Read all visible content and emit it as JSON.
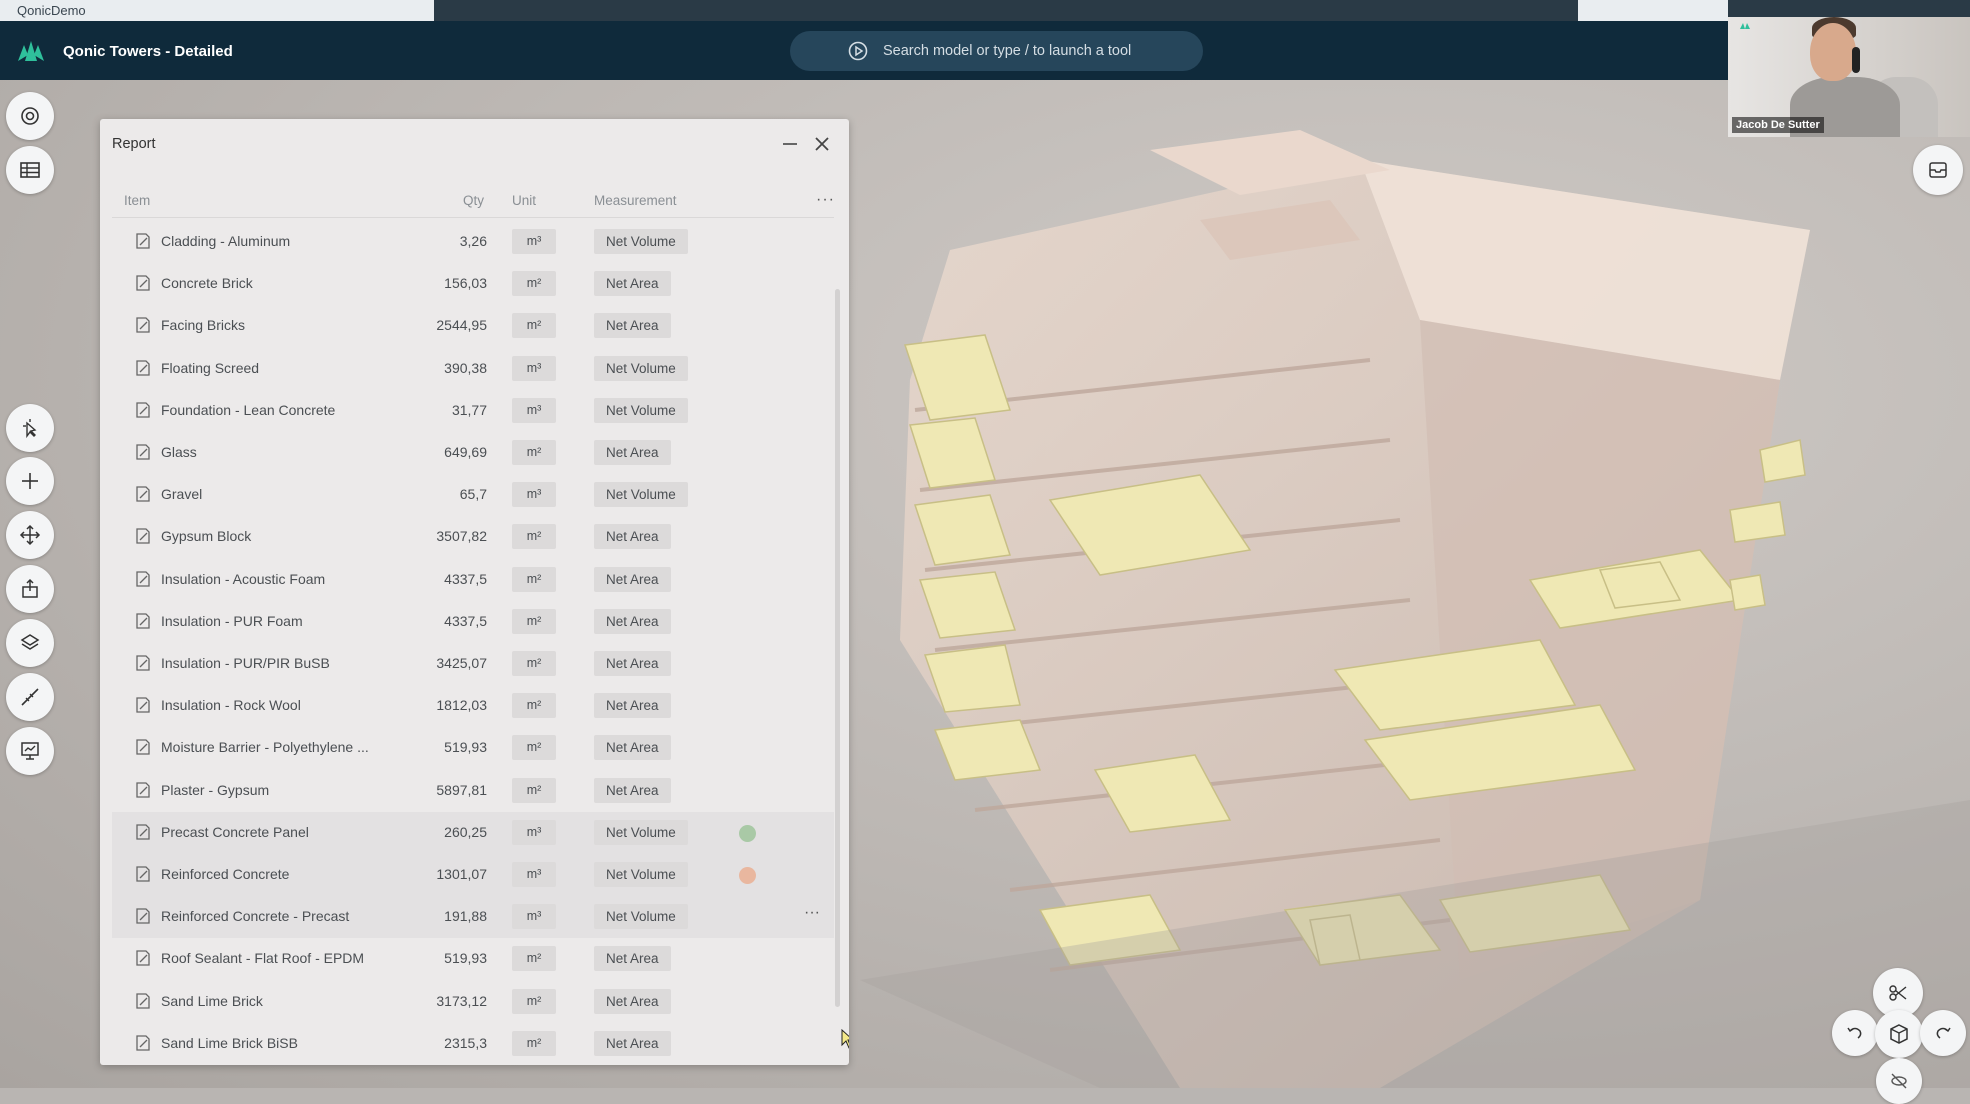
{
  "browser": {
    "tab_title": "QonicDemo"
  },
  "app": {
    "title": "Qonic Towers - Detailed",
    "search_placeholder": "Search model or type / to launch a tool"
  },
  "video": {
    "participant_name": "Jacob De Sutter"
  },
  "report": {
    "title": "Report",
    "columns": {
      "item": "Item",
      "qty": "Qty",
      "unit": "Unit",
      "measurement": "Measurement"
    },
    "rows": [
      {
        "item": "Cladding - Aluminum",
        "qty": "3,26",
        "unit": "m³",
        "measurement": "Net Volume"
      },
      {
        "item": "Concrete Brick",
        "qty": "156,03",
        "unit": "m²",
        "measurement": "Net Area"
      },
      {
        "item": "Facing Bricks",
        "qty": "2544,95",
        "unit": "m²",
        "measurement": "Net Area"
      },
      {
        "item": "Floating Screed",
        "qty": "390,38",
        "unit": "m³",
        "measurement": "Net Volume"
      },
      {
        "item": "Foundation - Lean Concrete",
        "qty": "31,77",
        "unit": "m³",
        "measurement": "Net Volume"
      },
      {
        "item": "Glass",
        "qty": "649,69",
        "unit": "m²",
        "measurement": "Net Area"
      },
      {
        "item": "Gravel",
        "qty": "65,7",
        "unit": "m³",
        "measurement": "Net Volume"
      },
      {
        "item": "Gypsum Block",
        "qty": "3507,82",
        "unit": "m²",
        "measurement": "Net Area"
      },
      {
        "item": "Insulation - Acoustic Foam",
        "qty": "4337,5",
        "unit": "m²",
        "measurement": "Net Area"
      },
      {
        "item": "Insulation - PUR Foam",
        "qty": "4337,5",
        "unit": "m²",
        "measurement": "Net Area"
      },
      {
        "item": "Insulation - PUR/PIR BuSB",
        "qty": "3425,07",
        "unit": "m²",
        "measurement": "Net Area"
      },
      {
        "item": "Insulation - Rock Wool",
        "qty": "1812,03",
        "unit": "m²",
        "measurement": "Net Area"
      },
      {
        "item": "Moisture Barrier - Polyethylene ...",
        "qty": "519,93",
        "unit": "m²",
        "measurement": "Net Area"
      },
      {
        "item": "Plaster - Gypsum",
        "qty": "5897,81",
        "unit": "m²",
        "measurement": "Net Area"
      },
      {
        "item": "Precast Concrete Panel",
        "qty": "260,25",
        "unit": "m³",
        "measurement": "Net Volume",
        "dot": "#a9c9a6"
      },
      {
        "item": "Reinforced Concrete",
        "qty": "1301,07",
        "unit": "m³",
        "measurement": "Net Volume",
        "dot": "#e9b79f"
      },
      {
        "item": "Reinforced Concrete - Precast",
        "qty": "191,88",
        "unit": "m³",
        "measurement": "Net Volume"
      },
      {
        "item": "Roof Sealant - Flat Roof - EPDM",
        "qty": "519,93",
        "unit": "m²",
        "measurement": "Net Area"
      },
      {
        "item": "Sand Lime Brick",
        "qty": "3173,12",
        "unit": "m²",
        "measurement": "Net Area"
      },
      {
        "item": "Sand Lime Brick BiSB",
        "qty": "2315,3",
        "unit": "m²",
        "measurement": "Net Area"
      }
    ]
  },
  "colors": {
    "appbar": "#0f2a3b",
    "accent": "#2fbf9b",
    "slab_highlight": "#efe8b0",
    "building": "#e7d6cb"
  }
}
